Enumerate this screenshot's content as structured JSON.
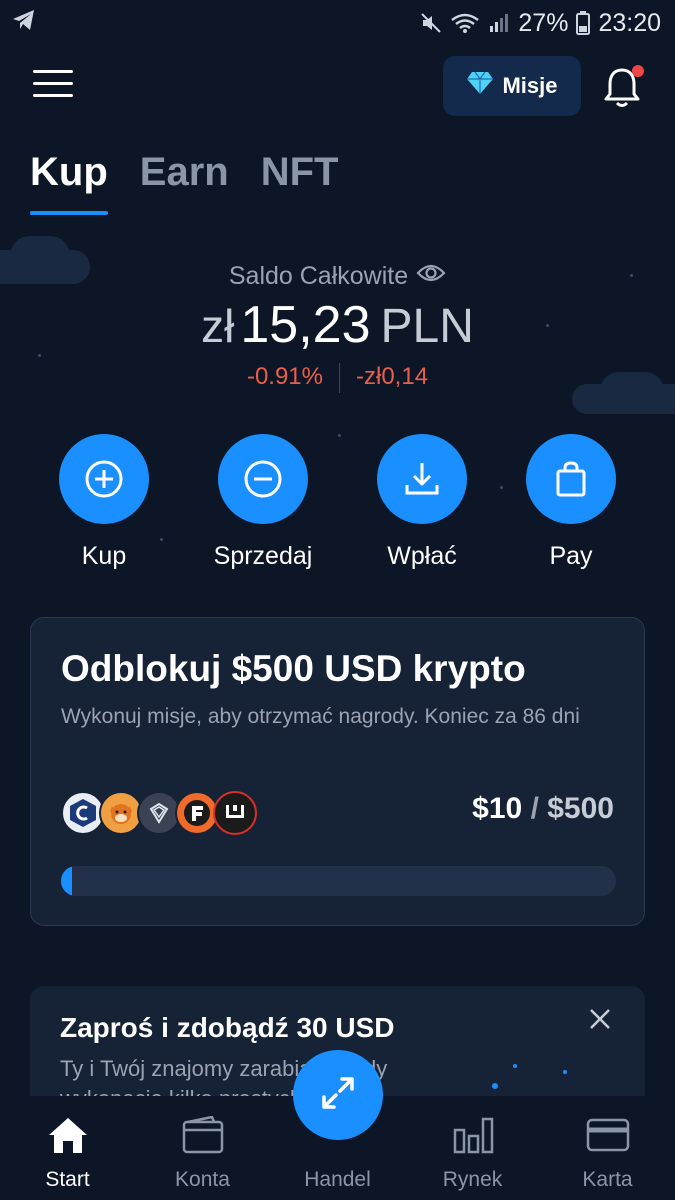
{
  "status_bar": {
    "battery": "27%",
    "time": "23:20",
    "icons": [
      "telegram-icon",
      "mute-icon",
      "wifi-icon",
      "signal-icon",
      "battery-icon"
    ]
  },
  "header": {
    "missions_label": "Misje",
    "missions_icon": "diamond-icon",
    "notification_icon": "bell-icon"
  },
  "tabs": [
    {
      "label": "Kup",
      "active": true
    },
    {
      "label": "Earn",
      "active": false
    },
    {
      "label": "NFT",
      "active": false
    }
  ],
  "balance": {
    "label": "Saldo Całkowite",
    "currency_symbol": "zł",
    "amount": "15,23",
    "currency_code": "PLN",
    "change_percent": "-0.91%",
    "change_value": "-zł0,14"
  },
  "actions": [
    {
      "label": "Kup",
      "icon": "plus-circle-icon"
    },
    {
      "label": "Sprzedaj",
      "icon": "minus-circle-icon"
    },
    {
      "label": "Wpłać",
      "icon": "download-icon"
    },
    {
      "label": "Pay",
      "icon": "shopping-bag-icon"
    }
  ],
  "promo": {
    "title": "Odblokuj $500 USD krypto",
    "subtitle": "Wykonuj misje, aby otrzymać nagrody. Koniec za 86 dni",
    "progress_current": "$10",
    "progress_separator": "/",
    "progress_max": "$500",
    "progress_fraction": 0.02,
    "coin_icons": [
      "cronos-icon",
      "shiba-icon",
      "diamond-coin-icon",
      "fantom-icon",
      "coin-logo-icon"
    ]
  },
  "invite": {
    "title": "Zaproś i zdobądź 30 USD",
    "subtitle": "Ty i Twój znajomy zarabiacie, gdy wykonacie kilka prostych"
  },
  "bottom_nav": [
    {
      "label": "Start",
      "icon": "home-icon",
      "active": true
    },
    {
      "label": "Konta",
      "icon": "wallet-icon",
      "active": false
    },
    {
      "label": "Handel",
      "icon": "swap-arrows-icon",
      "active": false
    },
    {
      "label": "Rynek",
      "icon": "bar-chart-icon",
      "active": false
    },
    {
      "label": "Karta",
      "icon": "credit-card-icon",
      "active": false
    }
  ],
  "colors": {
    "background": "#0d1626",
    "accent": "#1a8fff",
    "negative": "#e8604c",
    "card": "#162236"
  }
}
